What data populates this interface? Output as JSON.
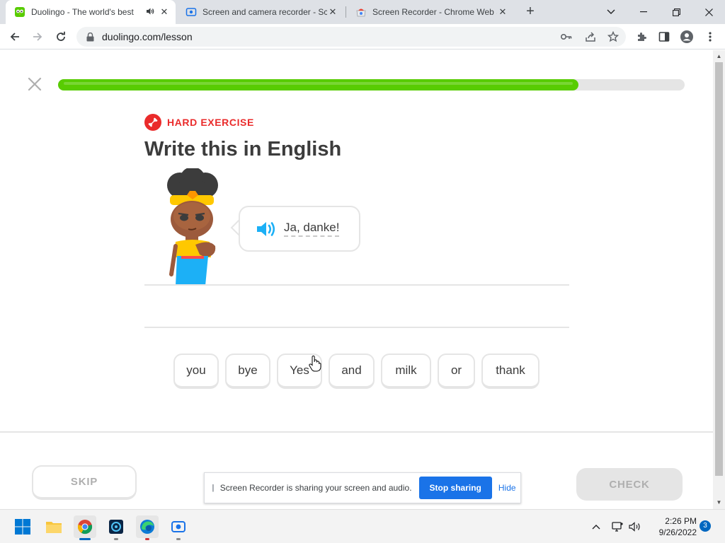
{
  "browser": {
    "tabs": [
      {
        "title": "Duolingo - The world's best",
        "active": true,
        "favicon": "duolingo-owl-icon",
        "audio": true
      },
      {
        "title": "Screen and camera recorder - Scr",
        "active": false,
        "favicon": "recorder-icon"
      },
      {
        "title": "Screen Recorder - Chrome Web S",
        "active": false,
        "favicon": "chrome-webstore-icon"
      }
    ],
    "new_tab_symbol": "+",
    "url": "duolingo.com/lesson"
  },
  "lesson": {
    "progress": 0.83,
    "badge": "HARD EXERCISE",
    "title": "Write this in English",
    "prompt_text": "Ja, danke!",
    "word_bank": [
      "you",
      "bye",
      "Yes",
      "and",
      "milk",
      "or",
      "thank"
    ],
    "skip_label": "SKIP",
    "check_label": "CHECK"
  },
  "share_bar": {
    "message": "Screen Recorder is sharing your screen and audio.",
    "stop_label": "Stop sharing",
    "hide_label": "Hide"
  },
  "taskbar": {
    "time": "2:26 PM",
    "date": "9/26/2022",
    "notification_count": "3"
  },
  "colors": {
    "progress_green": "#58cc02",
    "hard_red": "#ea2b2b",
    "speaker_blue": "#1cb0f6",
    "chrome_blue": "#1a73e8"
  }
}
